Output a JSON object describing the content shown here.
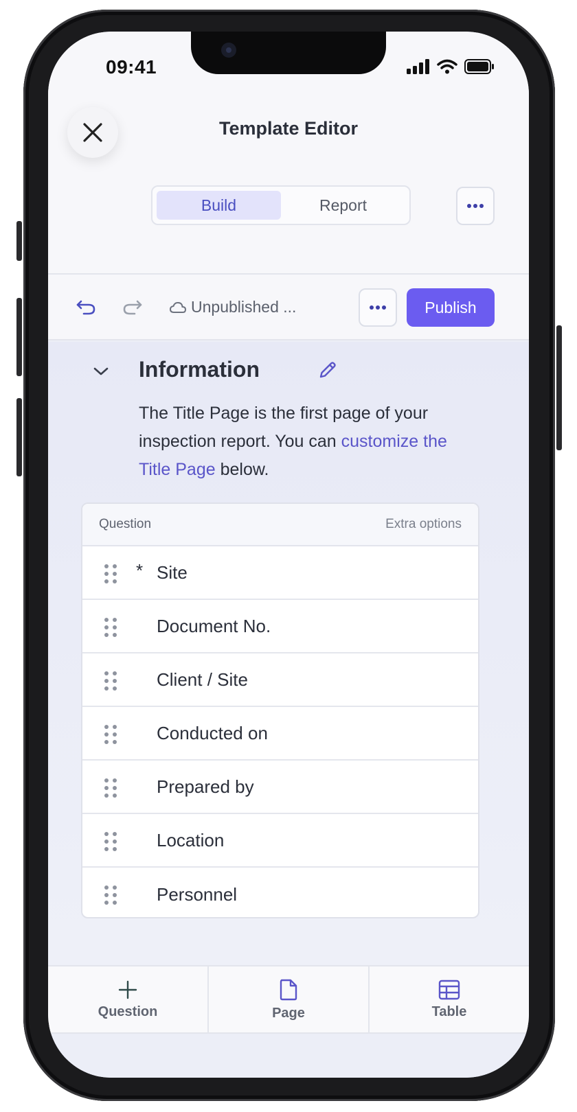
{
  "status_bar": {
    "time": "09:41"
  },
  "header": {
    "title": "Template Editor",
    "tabs": [
      {
        "label": "Build",
        "active": true
      },
      {
        "label": "Report",
        "active": false
      }
    ]
  },
  "toolbar": {
    "status_text": "Unpublished ...",
    "publish_label": "Publish"
  },
  "section": {
    "title": "Information",
    "description_prefix": "The Title Page is the first page of your inspection report. You can ",
    "description_link": "customize the Title Page",
    "description_suffix": " below."
  },
  "table": {
    "col_question": "Question",
    "col_extra": "Extra options",
    "required_marker": "*",
    "rows": [
      {
        "label": "Site",
        "required": true
      },
      {
        "label": "Document No.",
        "required": false
      },
      {
        "label": "Client / Site",
        "required": false
      },
      {
        "label": "Conducted on",
        "required": false
      },
      {
        "label": "Prepared by",
        "required": false
      },
      {
        "label": "Location",
        "required": false
      },
      {
        "label": "Personnel",
        "required": false
      }
    ]
  },
  "bottom_bar": {
    "items": [
      {
        "label": "Question",
        "icon": "plus-icon"
      },
      {
        "label": "Page",
        "icon": "page-icon"
      },
      {
        "label": "Table",
        "icon": "table-icon"
      }
    ]
  },
  "colors": {
    "accent": "#6b5cf0",
    "link": "#5a55c9",
    "active_tab_bg": "#e3e3fb"
  }
}
